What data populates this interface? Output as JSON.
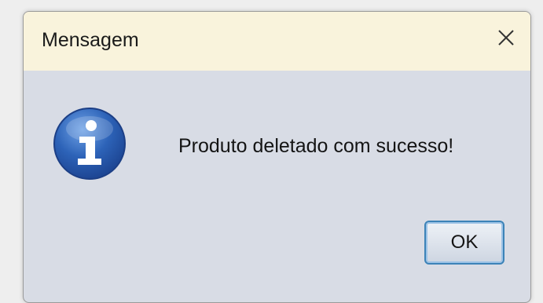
{
  "dialog": {
    "title": "Mensagem",
    "message": "Produto deletado com sucesso!",
    "ok_label": "OK",
    "close_glyph": "✕",
    "icon": "info-icon"
  },
  "colors": {
    "titlebar_bg": "#f9f3dc",
    "body_bg": "#d8dce5",
    "icon_blue": "#2d63b8",
    "button_border": "#3c83b8"
  }
}
